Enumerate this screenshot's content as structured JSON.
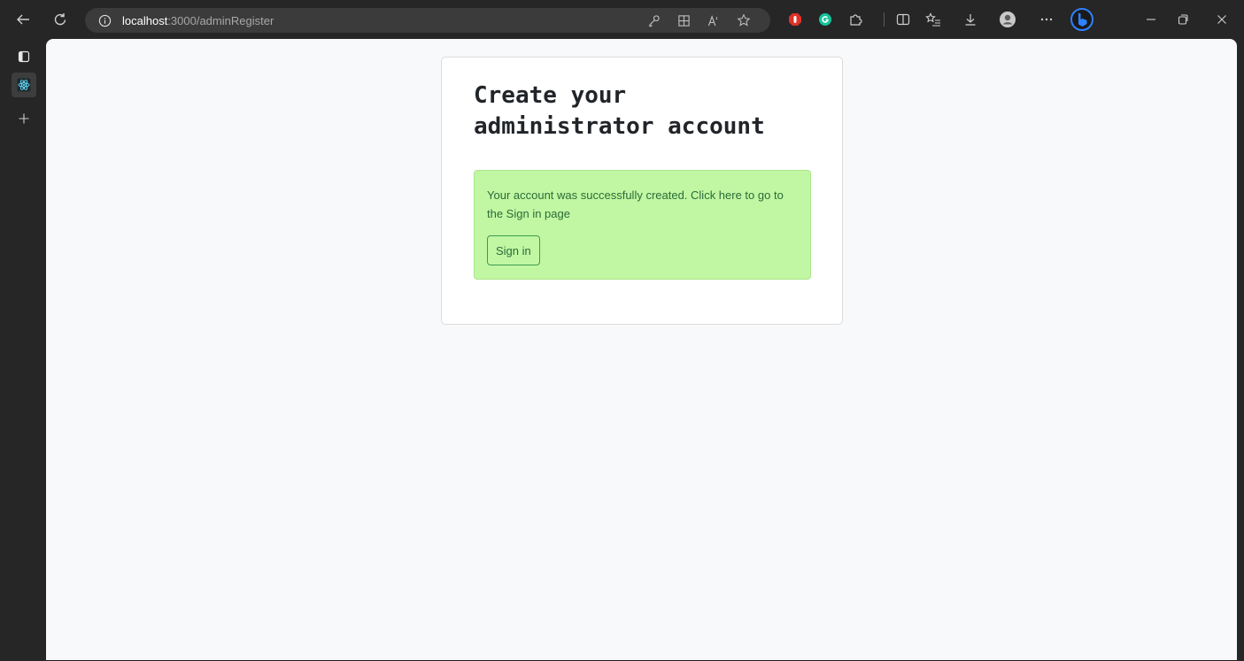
{
  "browser": {
    "address_bar": {
      "host": "localhost",
      "path": ":3000/adminRegister"
    },
    "colors": {
      "chrome_bg": "#262626",
      "address_bg": "#3b3b3b",
      "extension_red": "#e0312b",
      "extension_green": "#15c39a",
      "bing_blue": "#1a73e8"
    },
    "toolbar_icons": [
      "back-icon",
      "refresh-icon",
      "info-icon",
      "key-icon",
      "apps-grid-icon",
      "read-aloud-icon",
      "favorite-star-icon",
      "adblock-extension-icon",
      "grammarly-extension-icon",
      "extensions-puzzle-icon",
      "split-screen-icon",
      "favorites-list-icon",
      "downloads-icon",
      "profile-avatar-icon",
      "more-options-icon",
      "bing-copilot-icon",
      "minimize-icon",
      "restore-icon",
      "close-icon"
    ],
    "rail_icons": [
      "tab-actions-icon",
      "react-tab-icon",
      "new-tab-plus-icon"
    ]
  },
  "page": {
    "heading_line1": "Create your",
    "heading_line2": "administrator account",
    "alert": {
      "message": "Your account was successfully created. Click here to go to the Sign in page",
      "button_label": "Sign in",
      "background": "#c1f7a2",
      "text_color": "#2a6b3a"
    }
  }
}
